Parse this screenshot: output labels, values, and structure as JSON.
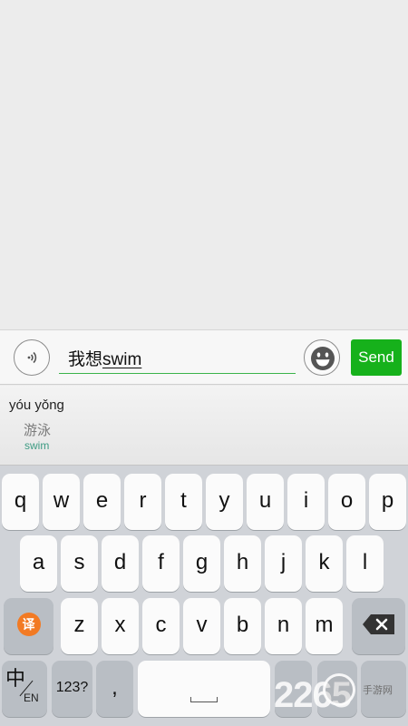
{
  "input_bar": {
    "voice_icon": "voice-wave-icon",
    "typed_value": "我想",
    "composing_value": "swim",
    "emoji_icon": "smile-emoji-icon",
    "send_label": "Send",
    "accent_color": "#16b11b"
  },
  "candidates": {
    "pinyin": "yóu yǒng",
    "hanzi": "游泳",
    "english": "swim"
  },
  "keyboard": {
    "row1": [
      "q",
      "w",
      "e",
      "r",
      "t",
      "y",
      "u",
      "i",
      "o",
      "p"
    ],
    "row2": [
      "a",
      "s",
      "d",
      "f",
      "g",
      "h",
      "j",
      "k",
      "l"
    ],
    "row3": [
      "z",
      "x",
      "c",
      "v",
      "b",
      "n",
      "m"
    ],
    "translate_key": "译",
    "lang_key_zh": "中",
    "lang_key_en": "EN",
    "numbers_key": "123?",
    "comma_key": ",",
    "delete_icon": "backspace-icon"
  },
  "watermark": {
    "digits": "2265",
    "site_text": "手游网"
  }
}
